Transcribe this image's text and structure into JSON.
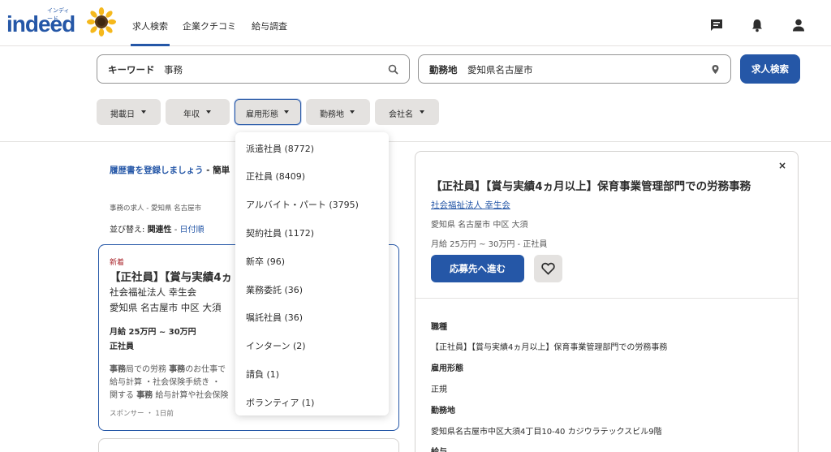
{
  "header": {
    "logo_small": "インディード",
    "logo_main": "indeed",
    "nav": [
      "求人検索",
      "企業クチコミ",
      "給与調査"
    ]
  },
  "search": {
    "keyword_label": "キーワード",
    "keyword_value": "事務",
    "location_label": "勤務地",
    "location_value": "愛知県名古屋市",
    "button": "求人検索"
  },
  "filters": [
    "掲載日",
    "年収",
    "雇用形態",
    "勤務地",
    "会社名"
  ],
  "left": {
    "resume_link": "履歴書を登録しましょう",
    "resume_suffix": " - 簡単",
    "breadcrumb": "事務の求人 - 愛知県 名古屋市",
    "sort_prefix": "並び替え: ",
    "sort_active": "関連性",
    "sort_sep": " - ",
    "sort_other": "日付順"
  },
  "card": {
    "badge": "新着",
    "title": "【正社員】【賞与実績4ヵ",
    "company": "社会福祉法人 幸生会",
    "location": "愛知県 名古屋市 中区 大須",
    "salary": "月給 25万円 ~ 30万円",
    "job_type": "正社員",
    "snippet_1_a": "事務",
    "snippet_1_b": "局での労務 ",
    "snippet_1_c": "事務",
    "snippet_1_d": "のお仕事で",
    "snippet_2": "給与計算 ・社会保険手続き ・",
    "snippet_3_a": "関する ",
    "snippet_3_b": "事務",
    "snippet_3_c": " 給与計算や社会保険",
    "footer": "スポンサー ・ 1日前"
  },
  "dropdown": [
    "派遣社員 (8772)",
    "正社員 (8409)",
    "アルバイト・パート (3795)",
    "契約社員 (1172)",
    "新卒 (96)",
    "業務委託 (36)",
    "嘱託社員 (36)",
    "インターン (2)",
    "請負 (1)",
    "ボランティア (1)"
  ],
  "panel": {
    "title": "【正社員】【賞与実績4ヵ月以上】保育事業管理部門での労務事務",
    "company": "社会福祉法人 幸生会",
    "location": "愛知県 名古屋市 中区 大須",
    "salary": "月給 25万円 ~ 30万円 - 正社員",
    "apply": "応募先へ進む",
    "close": "×",
    "details": [
      {
        "head": "職種",
        "value": "【正社員】【賞与実績4ヵ月以上】保育事業管理部門での労務事務"
      },
      {
        "head": "雇用形態",
        "value": "正規"
      },
      {
        "head": "勤務地",
        "value": "愛知県名古屋市中区大須4丁目10-40 カジウラテックスビル9階"
      },
      {
        "head": "給与",
        "value": ""
      }
    ]
  },
  "colors": {
    "brand_blue": "#2557a7",
    "chip_bg": "#e4e2e0",
    "new_badge": "#a9252b"
  }
}
